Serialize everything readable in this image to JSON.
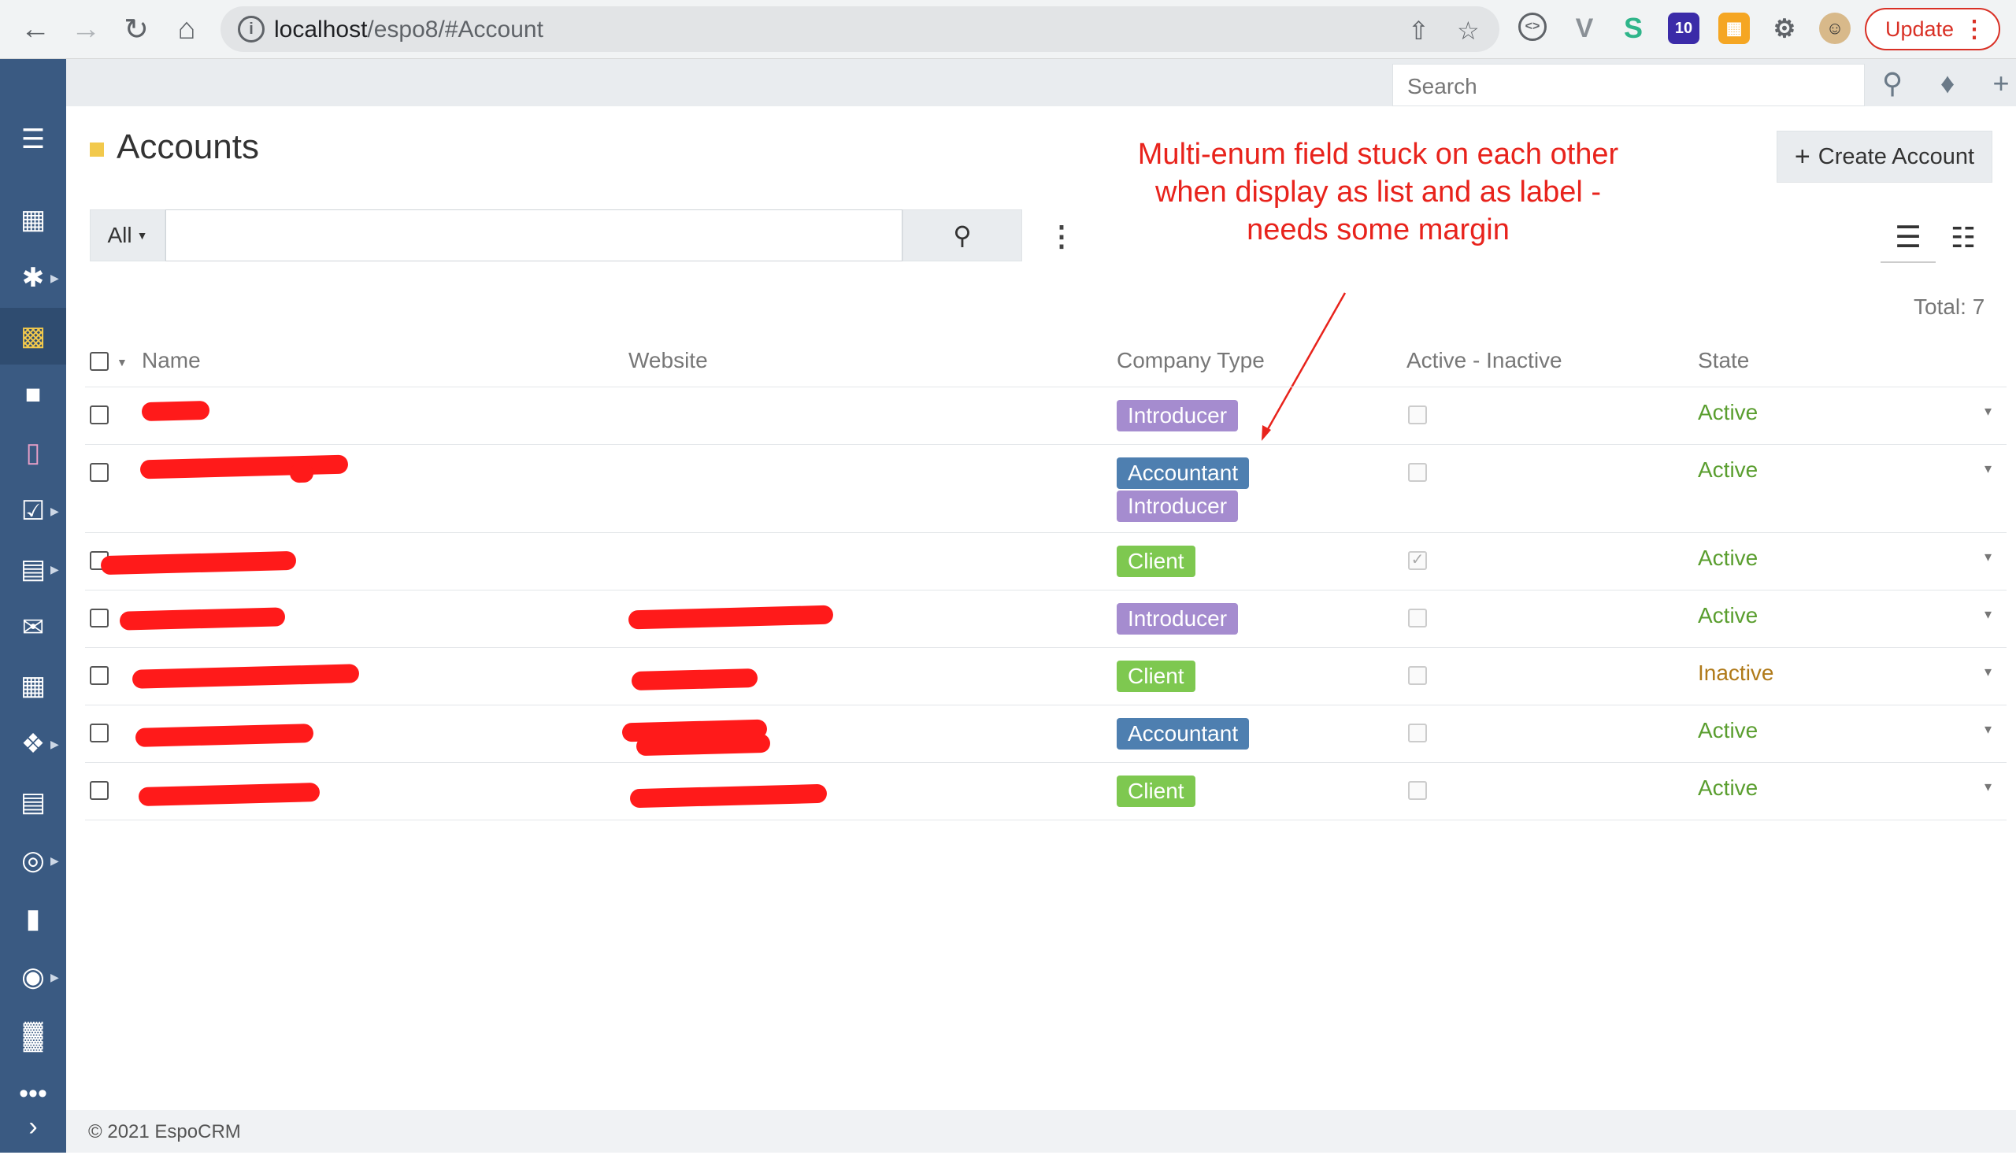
{
  "browser": {
    "url_host": "localhost",
    "url_path": "/espo8/#Account",
    "update_label": "Update",
    "ext_badge": "10"
  },
  "topbar": {
    "search_placeholder": "Search"
  },
  "page": {
    "title": "Accounts",
    "create_label": "Create Account",
    "filter_all": "All",
    "total": "Total: 7"
  },
  "annotation": {
    "text": "Multi-enum field stuck on each other when display as list and as label - needs some margin"
  },
  "table": {
    "columns": [
      "Name",
      "Website",
      "Company Type",
      "Active - Inactive",
      "State"
    ],
    "rows": [
      {
        "types": [
          "Introducer"
        ],
        "active_checked": false,
        "state": "Active"
      },
      {
        "types": [
          "Accountant",
          "Introducer"
        ],
        "active_checked": false,
        "state": "Active"
      },
      {
        "types": [
          "Client"
        ],
        "active_checked": true,
        "state": "Active"
      },
      {
        "types": [
          "Introducer"
        ],
        "active_checked": false,
        "state": "Active"
      },
      {
        "types": [
          "Client"
        ],
        "active_checked": false,
        "state": "Inactive"
      },
      {
        "types": [
          "Accountant"
        ],
        "active_checked": false,
        "state": "Active"
      },
      {
        "types": [
          "Client"
        ],
        "active_checked": false,
        "state": "Active"
      }
    ]
  },
  "colors": {
    "sidebar": "#3a5a82",
    "introducer": "#a58ccf",
    "accountant": "#4e7fb0",
    "client": "#7ec850",
    "state_active": "#5a9e2f",
    "state_inactive": "#b07a1a",
    "annotation": "#e8231c"
  },
  "footer": {
    "copyright": "© 2021 EspoCRM"
  }
}
